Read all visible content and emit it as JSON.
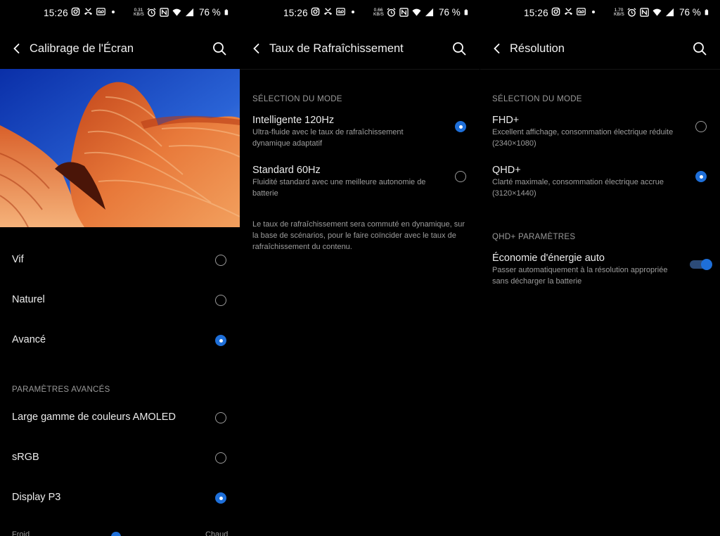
{
  "screens": [
    {
      "status": {
        "time": "15:26",
        "speed_top": "0.31",
        "speed_bottom": "KB/S",
        "battery": "76 %"
      },
      "title": "Calibrage de l'Écran",
      "options": [
        {
          "label": "Vif",
          "selected": false
        },
        {
          "label": "Naturel",
          "selected": false
        },
        {
          "label": "Avancé",
          "selected": true
        }
      ],
      "advanced_section": "PARAMÈTRES AVANCÉS",
      "advanced": [
        {
          "label": "Large gamme de couleurs AMOLED",
          "selected": false
        },
        {
          "label": "sRGB",
          "selected": false
        },
        {
          "label": "Display P3",
          "selected": true
        }
      ],
      "slider_left": "Froid",
      "slider_right": "Chaud"
    },
    {
      "status": {
        "time": "15:26",
        "speed_top": "0.66",
        "speed_bottom": "KB/S",
        "battery": "76 %"
      },
      "title": "Taux de Rafraîchissement",
      "section": "SÉLECTION DU MODE",
      "modes": [
        {
          "title": "Intelligente 120Hz",
          "sub": "Ultra-fluide avec le taux de rafraîchissement dynamique adaptatif",
          "selected": true
        },
        {
          "title": "Standard 60Hz",
          "sub": "Fluidité standard avec une meilleure autonomie de batterie",
          "selected": false
        }
      ],
      "note": "Le taux de rafraîchissement sera commuté en dynamique, sur la base de scénarios, pour le faire coïncider avec le taux de rafraîchissement du contenu."
    },
    {
      "status": {
        "time": "15:26",
        "speed_top": "1.70",
        "speed_bottom": "KB/S",
        "battery": "76 %"
      },
      "title": "Résolution",
      "section": "SÉLECTION DU MODE",
      "modes": [
        {
          "title": "FHD+",
          "sub": "Excellent affichage, consommation électrique réduite (2340×1080)",
          "selected": false
        },
        {
          "title": "QHD+",
          "sub": "Clarté maximale, consommation électrique accrue (3120×1440)",
          "selected": true
        }
      ],
      "params_section": "QHD+ PARAMÈTRES",
      "power_saving": {
        "title": "Économie d'énergie auto",
        "sub": "Passer automatiquement à la résolution appropriée sans décharger la batterie",
        "enabled": true
      }
    }
  ],
  "colors": {
    "accent": "#1e6fd9",
    "background": "#000000"
  },
  "icons": [
    "back-arrow-icon",
    "search-icon",
    "instagram-icon",
    "missed-call-icon",
    "voicemail-icon",
    "alarm-icon",
    "nfc-icon",
    "wifi-icon",
    "signal-icon",
    "battery-icon",
    "radio-selected-icon",
    "radio-unselected-icon"
  ]
}
